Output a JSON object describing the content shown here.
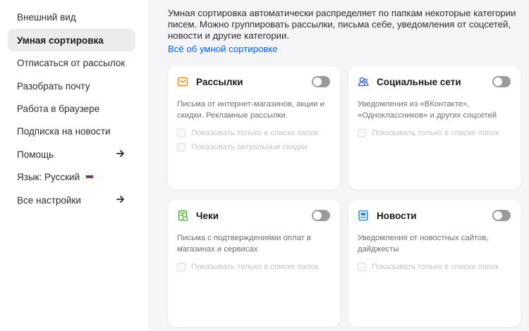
{
  "sidebar": {
    "items": [
      {
        "label": "Внешний вид"
      },
      {
        "label": "Умная сортировка",
        "active": true
      },
      {
        "label": "Отписаться от рассылок"
      },
      {
        "label": "Разобрать почту"
      },
      {
        "label": "Работа в браузере"
      },
      {
        "label": "Подписка на новости"
      },
      {
        "label": "Помощь",
        "arrow": true
      },
      {
        "label": "Язык: Русский",
        "flag": "russia-flag-icon"
      },
      {
        "label": "Все настройки",
        "arrow": true
      }
    ]
  },
  "main": {
    "intro": "Умная сортировка автоматически распределяет по папкам некоторые категории писем. Можно группировать рассылки, письма себе, уведомления от соцсетей, новости и другие категории.",
    "link": "Всё об умной сортировке",
    "cards": [
      {
        "icon": "newsletter-icon",
        "title": "Рассылки",
        "toggle_on": false,
        "description": "Письма от интернет-магазинов, акции и скидки. Рекламные рассылки.",
        "options": [
          "Показывать только в списке папок",
          "Показывать актуальные скидки"
        ]
      },
      {
        "icon": "social-people-icon",
        "title": "Социальные сети",
        "toggle_on": false,
        "description": "Уведомления из «ВКонтакте», «Одноклассников» и других соцсетей",
        "options": [
          "Показывать только в списке папок"
        ]
      },
      {
        "icon": "receipt-icon",
        "title": "Чеки",
        "toggle_on": false,
        "description": "Письма с подтверждениями оплат в магазинах и сервисах",
        "options": [
          "Показывать только в списке папок"
        ]
      },
      {
        "icon": "news-icon",
        "title": "Новости",
        "toggle_on": false,
        "description": "Уведомления от новостных сайтов, дайджесты",
        "options": [
          "Показывать только в списке папок"
        ]
      }
    ]
  },
  "colors": {
    "accent_link": "#005ff9",
    "newsletter_icon": "#f08a1c",
    "social_icon": "#3a62c8",
    "receipt_icon": "#4caf2a",
    "news_icon": "#2b8ad6",
    "toggle_off": "#9a9ba0"
  }
}
